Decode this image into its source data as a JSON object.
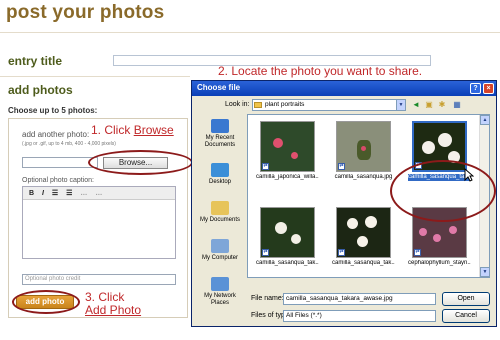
{
  "page": {
    "title": "post your photos",
    "entry_title_label": "entry title",
    "add_photos_heading": "add photos",
    "choose_up_to": "Choose up to 5 photos:",
    "add_another_label": "add another photo:",
    "file_hint": "(.jpg or .gif, up to 4 mb, 400 - 4,000 pixels)",
    "browse_label": "Browse...",
    "caption_label": "Optional photo caption:",
    "editor_buttons": [
      "B",
      "I",
      "☰",
      "☰",
      "…",
      "…"
    ],
    "photo_credit_placeholder": "Optional photo credit",
    "add_photo_button": "add photo"
  },
  "instructions": {
    "step1_prefix": "1. Click ",
    "step1_link": "Browse",
    "step2": "2. Locate the photo you want to share.",
    "step3_line1": "3. Click",
    "step3_link": "Add Photo"
  },
  "dialog": {
    "title": "Choose file",
    "help_btn": "?",
    "close_btn": "×",
    "look_in_label": "Look in:",
    "look_in_value": "plant portraits",
    "sidebar": [
      {
        "label": "My Recent Documents",
        "icon": "recent-documents-icon",
        "color": "#3a78d0"
      },
      {
        "label": "Desktop",
        "icon": "desktop-icon",
        "color": "#3b8fd8"
      },
      {
        "label": "My Documents",
        "icon": "my-documents-icon",
        "color": "#e7c45a"
      },
      {
        "label": "My Computer",
        "icon": "my-computer-icon",
        "color": "#7ea6d8"
      },
      {
        "label": "My Network Places",
        "icon": "network-places-icon",
        "color": "#5a92d6"
      }
    ],
    "files": [
      {
        "name": "camilla_japonica_willa...",
        "thumb_color": "#2e4a2a",
        "flower_color": "#e0506e"
      },
      {
        "name": "camilla_sasanqua.jpg",
        "thumb_color": "#8a8f7a",
        "flower_color": "#d84a6a"
      },
      {
        "name": "camilla_sasanqua_takara_awase.jpg",
        "thumb_color": "#1e2a12",
        "flower_color": "#f4f0ea",
        "selected": true
      },
      {
        "name": "camilla_sasanqua_tak...",
        "thumb_color": "#243a1c",
        "flower_color": "#f2efe6"
      },
      {
        "name": "camilla_sasanqua_tak...",
        "thumb_color": "#1c2614",
        "flower_color": "#f7f3ea"
      },
      {
        "name": "cephalophyllum_stayn...",
        "thumb_color": "#5a3a44",
        "flower_color": "#e07aa8"
      }
    ],
    "file_name_label": "File name:",
    "file_name_value": "camilla_sasanqua_takara_awase.jpg",
    "files_of_type_label": "Files of type:",
    "files_of_type_value": "All Files (*.*)",
    "open_button": "Open",
    "cancel_button": "Cancel"
  },
  "colors": {
    "accent_red": "#c0282a",
    "oval": "#8c1a1a",
    "xp_blue": "#0a3fb7",
    "selection": "#316ac5"
  }
}
